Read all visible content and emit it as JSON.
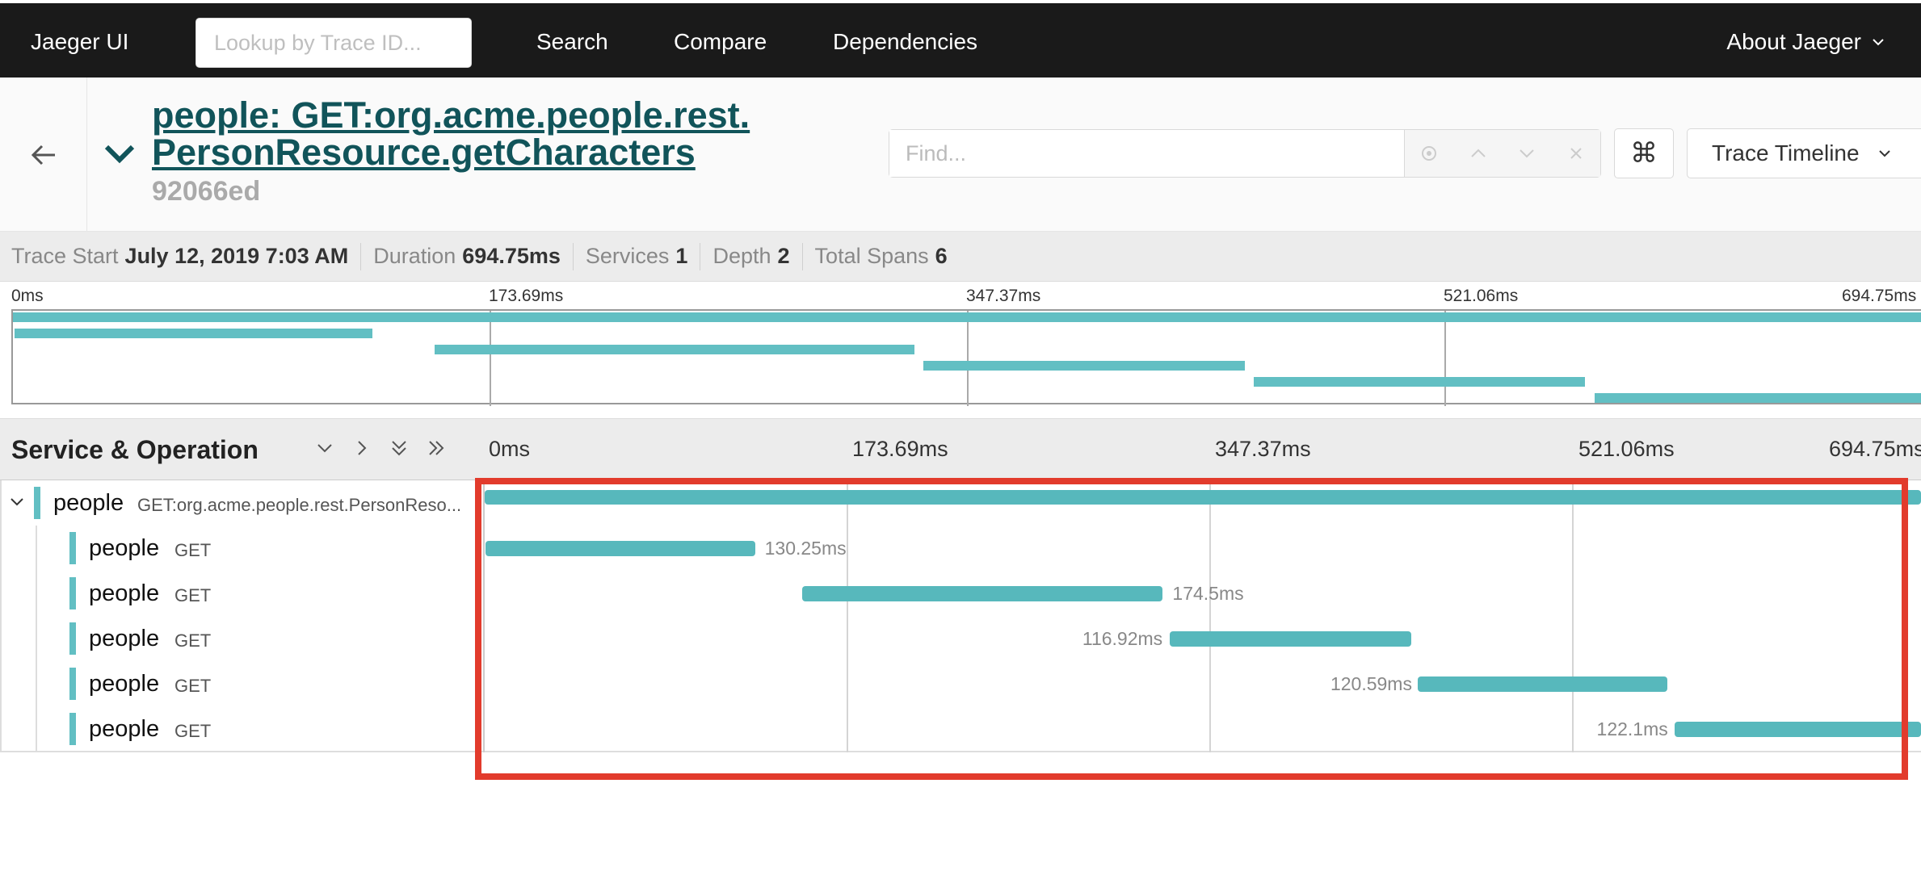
{
  "nav": {
    "brand": "Jaeger UI",
    "lookup_placeholder": "Lookup by Trace ID...",
    "links": [
      "Search",
      "Compare",
      "Dependencies"
    ],
    "about": "About Jaeger"
  },
  "trace": {
    "title_line1": "people: GET:org.acme.people.rest.",
    "title_line2": "PersonResource.getCharacters",
    "trace_id": "92066ed",
    "find_placeholder": "Find...",
    "kbd_glyph": "⌘",
    "view_mode": "Trace Timeline"
  },
  "overview": {
    "trace_start_label": "Trace Start",
    "trace_start_value": "July 12, 2019 7:03 AM",
    "duration_label": "Duration",
    "duration_value": "694.75ms",
    "services_label": "Services",
    "services_value": "1",
    "depth_label": "Depth",
    "depth_value": "2",
    "total_spans_label": "Total Spans",
    "total_spans_value": "6"
  },
  "ticks": [
    "0ms",
    "173.69ms",
    "347.37ms",
    "521.06ms",
    "694.75ms"
  ],
  "timeline": {
    "header": "Service & Operation",
    "total_ms": 694.75,
    "spans": [
      {
        "service": "people",
        "operation": "GET:org.acme.people.rest.PersonReso...",
        "start_ms": 0,
        "duration_ms": 694.75,
        "depth": 0,
        "label": "",
        "collapsible": true
      },
      {
        "service": "people",
        "operation": "GET",
        "start_ms": 0.5,
        "duration_ms": 130.25,
        "depth": 1,
        "label": "130.25ms",
        "label_side": "right"
      },
      {
        "service": "people",
        "operation": "GET",
        "start_ms": 153.5,
        "duration_ms": 174.5,
        "depth": 1,
        "label": "174.5ms",
        "label_side": "right"
      },
      {
        "service": "people",
        "operation": "GET",
        "start_ms": 331.3,
        "duration_ms": 116.92,
        "depth": 1,
        "label": "116.92ms",
        "label_side": "left"
      },
      {
        "service": "people",
        "operation": "GET",
        "start_ms": 451.3,
        "duration_ms": 120.59,
        "depth": 1,
        "label": "120.59ms",
        "label_side": "left"
      },
      {
        "service": "people",
        "operation": "GET",
        "start_ms": 575.4,
        "duration_ms": 119.35,
        "depth": 1,
        "label": "122.1ms",
        "label_side": "left"
      }
    ]
  },
  "colors": {
    "span": "#57b8bc",
    "nav_bg": "#1a1a1a",
    "title": "#11545a",
    "highlight": "#e23b2c"
  }
}
